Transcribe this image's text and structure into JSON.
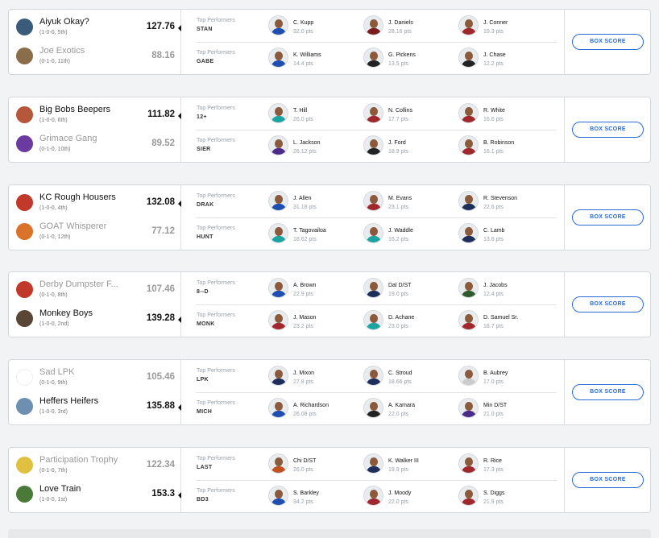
{
  "labels": {
    "top_performers": "Top Performers",
    "box_score": "BOX SCORE"
  },
  "matchups": [
    {
      "teams": [
        {
          "name": "Aiyuk Okay?",
          "record": "(1-0-0, 5th)",
          "score": "127.76",
          "winner": true,
          "logo_color": "#3b5b7a"
        },
        {
          "name": "Joe Exotics",
          "record": "(0-1-0, 11th)",
          "score": "88.16",
          "winner": false,
          "logo_color": "#8a6d4a"
        }
      ],
      "performers": [
        {
          "owner": "STAN",
          "players": [
            {
              "name": "C. Kupp",
              "pts": "32.0 pts",
              "color": "#1e4fb0"
            },
            {
              "name": "J. Daniels",
              "pts": "28.16 pts",
              "color": "#7a1c1c"
            },
            {
              "name": "J. Conner",
              "pts": "19.3 pts",
              "color": "#a0282d"
            }
          ]
        },
        {
          "owner": "GABE",
          "players": [
            {
              "name": "K. Williams",
              "pts": "14.4 pts",
              "color": "#1e4fb0"
            },
            {
              "name": "G. Pickens",
              "pts": "13.5 pts",
              "color": "#222222"
            },
            {
              "name": "J. Chase",
              "pts": "12.2 pts",
              "color": "#222222"
            }
          ]
        }
      ]
    },
    {
      "teams": [
        {
          "name": "Big Bobs Beepers",
          "record": "(1-0-0, 6th)",
          "score": "111.82",
          "winner": true,
          "logo_color": "#b5573a"
        },
        {
          "name": "Grimace Gang",
          "record": "(0-1-0, 10th)",
          "score": "89.52",
          "winner": false,
          "logo_color": "#6a3aa0"
        }
      ],
      "performers": [
        {
          "owner": "12+",
          "players": [
            {
              "name": "T. Hill",
              "pts": "26.0 pts",
              "color": "#1aa3a0"
            },
            {
              "name": "N. Collins",
              "pts": "17.7 pts",
              "color": "#a0282d"
            },
            {
              "name": "R. White",
              "pts": "16.6 pts",
              "color": "#a0282d"
            }
          ]
        },
        {
          "owner": "SIER",
          "players": [
            {
              "name": "L. Jackson",
              "pts": "26.12 pts",
              "color": "#4b2a8a"
            },
            {
              "name": "J. Ford",
              "pts": "18.9 pts",
              "color": "#222222"
            },
            {
              "name": "B. Robinson",
              "pts": "16.1 pts",
              "color": "#a0282d"
            }
          ]
        }
      ]
    },
    {
      "teams": [
        {
          "name": "KC Rough Housers",
          "record": "(1-0-0, 4th)",
          "score": "132.08",
          "winner": true,
          "logo_color": "#c0392b"
        },
        {
          "name": "GOAT Whisperer",
          "record": "(0-1-0, 12th)",
          "score": "77.12",
          "winner": false,
          "logo_color": "#d9732b"
        }
      ],
      "performers": [
        {
          "owner": "DRAK",
          "players": [
            {
              "name": "J. Allen",
              "pts": "31.18 pts",
              "color": "#1e4fb0"
            },
            {
              "name": "M. Evans",
              "pts": "23.1 pts",
              "color": "#a0282d"
            },
            {
              "name": "R. Stevenson",
              "pts": "22.6 pts",
              "color": "#1e2e5a"
            }
          ]
        },
        {
          "owner": "HUNT",
          "players": [
            {
              "name": "T. Tagovailoa",
              "pts": "18.62 pts",
              "color": "#1aa3a0"
            },
            {
              "name": "J. Waddle",
              "pts": "16.2 pts",
              "color": "#1aa3a0"
            },
            {
              "name": "C. Lamb",
              "pts": "13.6 pts",
              "color": "#1e2e5a"
            }
          ]
        }
      ]
    },
    {
      "teams": [
        {
          "name": "Derby Dumpster F...",
          "record": "(0-1-0, 8th)",
          "score": "107.46",
          "winner": false,
          "logo_color": "#c0392b"
        },
        {
          "name": "Monkey Boys",
          "record": "(1-0-0, 2nd)",
          "score": "139.28",
          "winner": true,
          "logo_color": "#5a4636"
        }
      ],
      "performers": [
        {
          "owner": "8--D",
          "players": [
            {
              "name": "A. Brown",
              "pts": "22.9 pts",
              "color": "#1e4fb0"
            },
            {
              "name": "Dal D/ST",
              "pts": "19.0 pts",
              "color": "#1e2e5a"
            },
            {
              "name": "J. Jacobs",
              "pts": "12.4 pts",
              "color": "#2e5a2e"
            }
          ]
        },
        {
          "owner": "MONK",
          "players": [
            {
              "name": "J. Mason",
              "pts": "23.2 pts",
              "color": "#a0282d"
            },
            {
              "name": "D. Achane",
              "pts": "23.0 pts",
              "color": "#1aa3a0"
            },
            {
              "name": "D. Samuel Sr.",
              "pts": "18.7 pts",
              "color": "#a0282d"
            }
          ]
        }
      ]
    },
    {
      "teams": [
        {
          "name": "Sad LPK",
          "record": "(0-1-0, 9th)",
          "score": "105.46",
          "winner": false,
          "logo_color": "#ffffff"
        },
        {
          "name": "Heffers Heifers",
          "record": "(1-0-0, 3rd)",
          "score": "135.88",
          "winner": true,
          "logo_color": "#6f8fb0"
        }
      ],
      "performers": [
        {
          "owner": "LPK",
          "players": [
            {
              "name": "J. Mixon",
              "pts": "27.8 pts",
              "color": "#1e2e5a"
            },
            {
              "name": "C. Stroud",
              "pts": "18.66 pts",
              "color": "#1e2e5a"
            },
            {
              "name": "B. Aubrey",
              "pts": "17.0 pts",
              "color": "#cccccc"
            }
          ]
        },
        {
          "owner": "MICH",
          "players": [
            {
              "name": "A. Richardson",
              "pts": "26.08 pts",
              "color": "#1e4fb0"
            },
            {
              "name": "A. Kamara",
              "pts": "22.0 pts",
              "color": "#222222"
            },
            {
              "name": "Min D/ST",
              "pts": "21.0 pts",
              "color": "#4b2a8a"
            }
          ]
        }
      ]
    },
    {
      "teams": [
        {
          "name": "Participation Trophy",
          "record": "(0-1-0, 7th)",
          "score": "122.34",
          "winner": false,
          "logo_color": "#e0c040"
        },
        {
          "name": "Love Train",
          "record": "(1-0-0, 1st)",
          "score": "153.3",
          "winner": true,
          "logo_color": "#4a7a3a"
        }
      ],
      "performers": [
        {
          "owner": "LAST",
          "players": [
            {
              "name": "Chi D/ST",
              "pts": "26.0 pts",
              "color": "#c0501e"
            },
            {
              "name": "K. Walker III",
              "pts": "19.9 pts",
              "color": "#1e2e5a"
            },
            {
              "name": "R. Rice",
              "pts": "17.3 pts",
              "color": "#a0282d"
            }
          ]
        },
        {
          "owner": "BD3",
          "players": [
            {
              "name": "S. Barkley",
              "pts": "34.2 pts",
              "color": "#1e4fb0"
            },
            {
              "name": "J. Moody",
              "pts": "22.0 pts",
              "color": "#a0282d"
            },
            {
              "name": "S. Diggs",
              "pts": "21.9 pts",
              "color": "#a0282d"
            }
          ]
        }
      ]
    }
  ]
}
